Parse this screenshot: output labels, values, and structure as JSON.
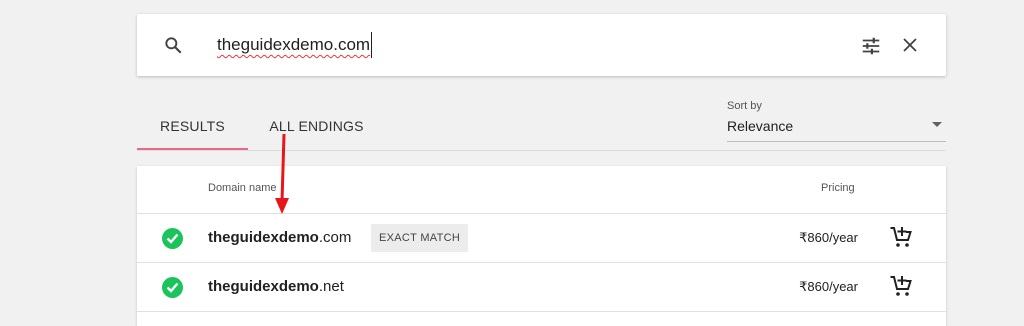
{
  "search": {
    "query": "theguidexdemo.com"
  },
  "tabs": [
    {
      "label": "RESULTS",
      "active": true
    },
    {
      "label": "ALL ENDINGS",
      "active": false
    }
  ],
  "sort": {
    "label": "Sort by",
    "value": "Relevance"
  },
  "results": {
    "columns": {
      "domain": "Domain name",
      "pricing": "Pricing"
    },
    "rows": [
      {
        "sld": "theguidexdemo",
        "tld": ".com",
        "badge": "EXACT MATCH",
        "price": "₹860/year",
        "available": true
      },
      {
        "sld": "theguidexdemo",
        "tld": ".net",
        "badge": "",
        "price": "₹860/year",
        "available": true
      }
    ]
  },
  "colors": {
    "accent_tab": "#e96a83",
    "available_check": "#1bc45b",
    "annotation_arrow": "#e8151a"
  },
  "icons": [
    "search-icon",
    "tune-icon",
    "close-icon",
    "checkmark-icon",
    "add-to-cart-icon",
    "dropdown-caret-icon"
  ]
}
